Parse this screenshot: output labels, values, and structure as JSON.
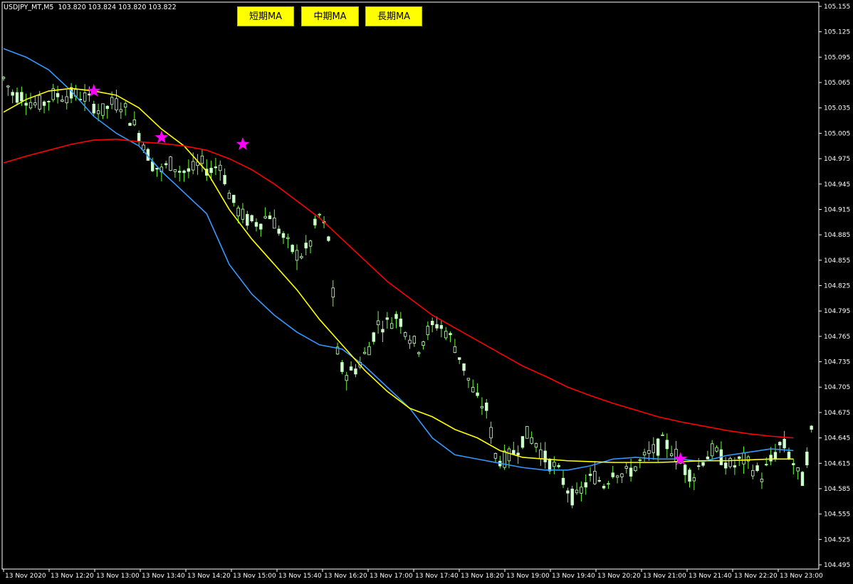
{
  "header": {
    "symbol": "USDJPY_MT,M5",
    "ohlc": "103.820 103.824 103.820 103.822"
  },
  "buttons": [
    {
      "label": "短期MA"
    },
    {
      "label": "中期MA"
    },
    {
      "label": "長期MA"
    }
  ],
  "colors": {
    "background": "#000000",
    "axis": "#ffffff",
    "candle": "#ccffcc",
    "wick": "#66ff33",
    "short_ma": "#3399ff",
    "mid_ma": "#ffff00",
    "long_ma": "#ff0000",
    "cross_star": "#ff00ff",
    "button_bg": "#ffff00"
  },
  "chart_data": {
    "type": "candlestick",
    "timeframe": "M5",
    "ylim": [
      104.49,
      105.16
    ],
    "y_ticks": [
      "105.155",
      "105.125",
      "105.095",
      "105.065",
      "105.035",
      "105.005",
      "104.975",
      "104.945",
      "104.915",
      "104.885",
      "104.855",
      "104.825",
      "104.795",
      "104.765",
      "104.735",
      "104.705",
      "104.675",
      "104.645",
      "104.615",
      "104.585",
      "104.555",
      "104.525",
      "104.495"
    ],
    "x_ticks": [
      "13 Nov 2020",
      "13 Nov 12:20",
      "13 Nov 13:00",
      "13 Nov 13:40",
      "13 Nov 14:20",
      "13 Nov 15:00",
      "13 Nov 15:40",
      "13 Nov 16:20",
      "13 Nov 17:00",
      "13 Nov 17:40",
      "13 Nov 18:20",
      "13 Nov 19:00",
      "13 Nov 19:40",
      "13 Nov 20:20",
      "13 Nov 21:00",
      "13 Nov 21:40",
      "13 Nov 22:20",
      "13 Nov 23:00"
    ],
    "close_sample": [
      105.07,
      105.05,
      105.05,
      105.04,
      105.04,
      105.05,
      105.05,
      105.05,
      105.05,
      105.04,
      105.03,
      105.04,
      105.04,
      105.02,
      105.0,
      104.97,
      104.96,
      104.97,
      104.96,
      104.96,
      104.97,
      104.96,
      104.97,
      104.93,
      104.91,
      104.9,
      104.9,
      104.91,
      104.89,
      104.87,
      104.86,
      104.87,
      104.91,
      104.88,
      104.73,
      104.72,
      104.73,
      104.75,
      104.78,
      104.78,
      104.79,
      104.77,
      104.75,
      104.77,
      104.78,
      104.77,
      104.75,
      104.72,
      104.69,
      104.68,
      104.62,
      104.62,
      104.63,
      104.65,
      104.64,
      104.62,
      104.61,
      104.59,
      104.57,
      104.59,
      104.6,
      104.59,
      104.61,
      104.6,
      104.61,
      104.62,
      104.63,
      104.64,
      104.63,
      104.61,
      104.6,
      104.62,
      104.63,
      104.62,
      104.61,
      104.62,
      104.61,
      104.6,
      104.62,
      104.64,
      104.62,
      104.59,
      104.65
    ],
    "series": [
      {
        "name": "短期MA",
        "color": "#3399ff",
        "x": [
          0,
          5,
          10,
          15,
          20,
          25,
          30,
          35,
          40,
          45,
          50,
          55,
          60,
          65,
          70,
          75,
          80,
          85,
          90,
          95,
          100,
          105,
          110,
          115,
          120,
          125,
          130,
          135,
          140,
          145,
          150,
          155,
          160,
          165,
          170,
          175
        ],
        "y": [
          105.105,
          105.095,
          105.08,
          105.055,
          105.025,
          105.005,
          104.99,
          104.96,
          104.935,
          104.91,
          104.85,
          104.815,
          104.79,
          104.77,
          104.755,
          104.75,
          104.73,
          104.705,
          104.68,
          104.645,
          104.625,
          104.62,
          104.615,
          104.61,
          104.607,
          104.607,
          104.612,
          104.62,
          104.622,
          104.62,
          104.62,
          104.617,
          104.624,
          104.628,
          104.632,
          104.63
        ]
      },
      {
        "name": "中期MA",
        "color": "#ffff00",
        "x": [
          0,
          5,
          10,
          15,
          20,
          25,
          30,
          35,
          40,
          45,
          50,
          55,
          60,
          65,
          70,
          75,
          80,
          85,
          90,
          95,
          100,
          105,
          110,
          115,
          120,
          125,
          130,
          135,
          140,
          145,
          150,
          155,
          160,
          165,
          170,
          175
        ],
        "y": [
          105.03,
          105.045,
          105.055,
          105.058,
          105.055,
          105.05,
          105.035,
          105.01,
          104.99,
          104.96,
          104.915,
          104.88,
          104.85,
          104.82,
          104.785,
          104.755,
          104.725,
          104.7,
          104.68,
          104.67,
          104.655,
          104.645,
          104.63,
          104.622,
          104.62,
          104.618,
          104.617,
          104.616,
          104.616,
          104.616,
          104.617,
          104.618,
          104.618,
          104.619,
          104.62,
          104.62
        ]
      },
      {
        "name": "長期MA",
        "color": "#ff0000",
        "x": [
          0,
          5,
          10,
          15,
          20,
          25,
          30,
          35,
          40,
          45,
          50,
          55,
          60,
          65,
          70,
          75,
          80,
          85,
          90,
          95,
          100,
          105,
          110,
          115,
          120,
          125,
          130,
          135,
          140,
          145,
          150,
          155,
          160,
          165,
          170,
          175
        ],
        "y": [
          104.97,
          104.978,
          104.985,
          104.992,
          104.997,
          104.998,
          104.995,
          104.993,
          104.99,
          104.985,
          104.975,
          104.962,
          104.945,
          104.925,
          104.905,
          104.88,
          104.855,
          104.83,
          104.81,
          104.79,
          104.775,
          104.76,
          104.745,
          104.73,
          104.718,
          104.705,
          104.695,
          104.686,
          104.678,
          104.67,
          104.664,
          104.659,
          104.654,
          104.65,
          104.647,
          104.645
        ]
      }
    ],
    "cross_markers": [
      {
        "x": 20,
        "y": 105.055
      },
      {
        "x": 35,
        "y": 105.0
      },
      {
        "x": 53,
        "y": 104.992
      },
      {
        "x": 150,
        "y": 104.62
      }
    ]
  }
}
